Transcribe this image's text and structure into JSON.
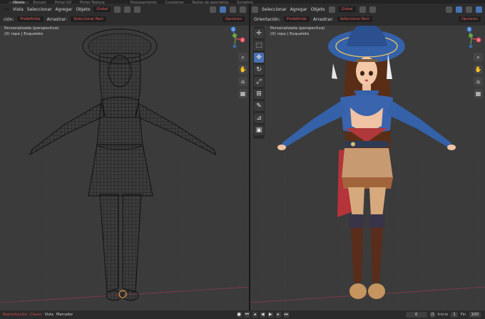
{
  "workspaces": [
    "",
    "Objeto",
    "Escupir",
    "Pintar UV",
    "Pintar Textura",
    "",
    "",
    "Procesamiento",
    "Componer",
    "Nodos de geometria",
    "Scripting"
  ],
  "active_workspace_index": 1,
  "left": {
    "header_row1": {
      "mode_dropdown": "",
      "menus": [
        "Vista",
        "Seleccionar",
        "Agregar",
        "Objeto"
      ],
      "transform_dropdown": "Global"
    },
    "header_row2": {
      "orientation_label": "ción:",
      "orientation_value": "Predefinida",
      "drag_label": "Arrastrar:",
      "drag_value": "Seleccionar Rect",
      "options_label": "Opciones"
    },
    "overlay_line1": "Personalizada (perspectiva)",
    "overlay_line2": "(0) ropa | Esqueleto",
    "gizmo": {
      "z": "Z",
      "y": "Y",
      "x": "X"
    }
  },
  "right": {
    "header_row1": {
      "menus": [
        "Seleccionar",
        "Agregar",
        "Objeto"
      ],
      "transform_dropdown": "Global"
    },
    "header_row2": {
      "orientation_label": "Orientación:",
      "orientation_value": "Predefinida",
      "drag_label": "Arrastrar:",
      "drag_value": "Seleccionar Rect",
      "options_label": "Opciones"
    },
    "overlay_line1": "Personalizada (perspectiva)",
    "overlay_line2": "(0) ropa | Esqueleto",
    "gizmo": {
      "z": "Z",
      "y": "Y",
      "x": "X"
    },
    "tools": [
      "cursor",
      "select-box",
      "move",
      "rotate",
      "scale",
      "transform",
      "annotate",
      "measure",
      "add-cube"
    ]
  },
  "statusbar": {
    "playback_dropdown": "Reproducción",
    "keying_dropdown": "Claves",
    "view_label": "Vista",
    "marker_label": "Marcador",
    "current_frame": "0",
    "start_label": "Inicio",
    "start_value": "1",
    "end_label": "Fin",
    "end_value": "100"
  },
  "colors": {
    "accent": "#4772b3",
    "axis_x": "#e04a5a",
    "axis_y": "#6aa63c",
    "axis_z": "#3b7fd8",
    "background": "#3b3b3b"
  }
}
